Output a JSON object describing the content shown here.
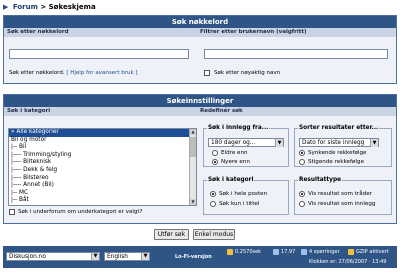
{
  "breadcrumb": {
    "arrow": "▶",
    "forum": "Forum",
    "separator": " > ",
    "current": "Søkeskjema"
  },
  "keyword_section": {
    "title": "Søk nøkkelord",
    "left_header": "Søk etter nøkkelord",
    "right_header": "Filtrer etter brukernavn (valgfritt)",
    "keyword_value": "",
    "username_value": "",
    "help_text": "Søk etter nøkkelord.",
    "help_link": "[ Hjelp for avansert bruk ]",
    "exact_name_label": "Søk etter nøyaktig navn"
  },
  "settings_section": {
    "title": "Søkeinnstillinger",
    "left_header": "Søk i kategori",
    "right_header": "Redefinér søk",
    "categories": [
      "» Alle kategorier",
      "Bil og motor",
      "|-- Bil",
      "|---- Trimming/styling",
      "|---- Bilteknisk",
      "|---- Dekk & felg",
      "|---- Bilstereo",
      "|---- Annet (Bil)",
      "|-- MC",
      "|-- Båt"
    ],
    "subforum_label": "Søk i underforum om underkategori er valgt?",
    "search_in_posts": {
      "legend": "Søk i innlegg fra...",
      "selected": "180 dager og...",
      "options": [
        "Eldre enn",
        "Nyere enn"
      ],
      "checked": 1
    },
    "sort": {
      "legend": "Sorter resultater etter...",
      "selected": "Dato for siste innlegg",
      "options": [
        "Synkende rekkefølge",
        "Stigende rekkefølge"
      ],
      "checked": 0
    },
    "category_scope": {
      "legend": "Søk i kategori",
      "options": [
        "Søk i hele posten",
        "Søk kun i tittel"
      ],
      "checked": 0
    },
    "result_type": {
      "legend": "Resultattype",
      "options": [
        "Vis resultat som tråder",
        "Vis resultat som innlegg"
      ],
      "checked": 0
    }
  },
  "buttons": {
    "search": "Utfør søk",
    "simple": "Enkel modus"
  },
  "footer": {
    "forum_select": "Diskusjon.no",
    "language_select": "English",
    "lofi": "Lo-Fi-versjon",
    "time_sec": "0.2570sek",
    "count_a": "17.97",
    "queries": "4 spørringer",
    "gzip": "GZIP aktivert",
    "clock": "Klokken er: 27/06/2007 · 13:49",
    "colors": {
      "bar": "#2f5587",
      "accent": "#f0c040"
    }
  }
}
